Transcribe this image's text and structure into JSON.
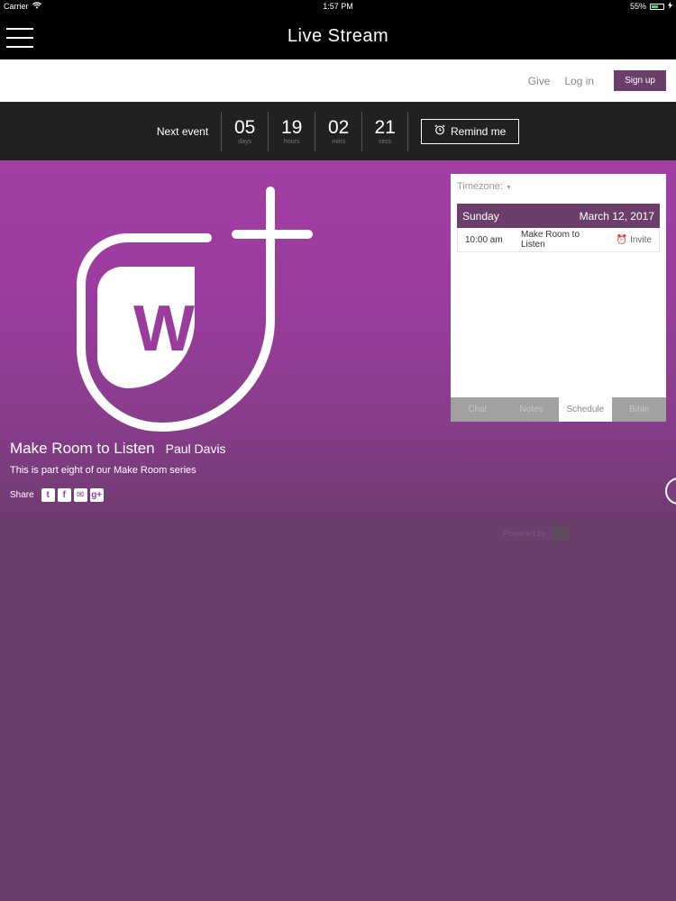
{
  "status_bar": {
    "carrier": "Carrier",
    "time": "1:57 PM",
    "battery": "55%",
    "battery_level": 0.55
  },
  "nav": {
    "title": "Live Stream"
  },
  "header": {
    "give": "Give",
    "login": "Log in",
    "signup": "Sign up"
  },
  "countdown": {
    "label": "Next event",
    "units": [
      {
        "value": "05",
        "label": "days"
      },
      {
        "value": "19",
        "label": "hours"
      },
      {
        "value": "02",
        "label": "mins"
      },
      {
        "value": "21",
        "label": "secs"
      }
    ],
    "remind": "Remind me"
  },
  "hero": {
    "title": "Make Room to Listen",
    "speaker": "Paul Davis",
    "description": "This is part eight of our Make Room series",
    "share_label": "Share",
    "share_icons": [
      "twitter-icon",
      "facebook-icon",
      "email-icon",
      "google-plus-icon"
    ],
    "logo_letter": "W"
  },
  "schedule": {
    "timezone": "Timezone:",
    "day": "Sunday",
    "date": "March 12, 2017",
    "event": {
      "time": "10:00 am",
      "title": "Make Room to Listen",
      "invite": "Invite"
    },
    "tabs": [
      "Chat",
      "Notes",
      "Schedule",
      "Bible"
    ],
    "active_tab": "Schedule"
  },
  "footer": {
    "powered_by": "Powered by"
  },
  "colors": {
    "brand": "#6c3e6a",
    "hero": "#9a3c9d",
    "page_bg": "#6a3f6a"
  }
}
